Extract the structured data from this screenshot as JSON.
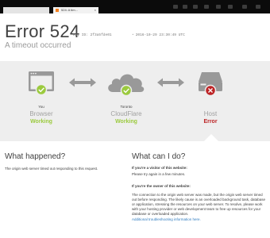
{
  "browser": {
    "tabs": [
      {
        "label": ""
      },
      {
        "label": "524: A tim...",
        "close": "×"
      }
    ]
  },
  "header": {
    "title": "Error 524",
    "ray_id": "Ray ID: 2f3a5fde01",
    "timestamp": "2016-10-29 23:30:49 UTC",
    "subtitle": "A timeout occurred"
  },
  "status": [
    {
      "place": "You",
      "name": "Browser",
      "state": "Working",
      "status": "ok"
    },
    {
      "place": "Toronto",
      "name": "CloudFlare",
      "state": "Working",
      "status": "ok"
    },
    {
      "place": "",
      "name": "Host",
      "state": "Error",
      "status": "error"
    }
  ],
  "what_happened": {
    "heading": "What happened?",
    "text": "The origin web server timed out responding to this request."
  },
  "what_can_i_do": {
    "heading": "What can I do?",
    "visitor_q": "If you're a visitor of this website:",
    "visitor_a": "Please try again in a few minutes.",
    "owner_q": "If you're the owner of this website:",
    "owner_a": "The connection to the origin web server was made, but the origin web server timed out before responding. The likely cause is an overloaded background task, database or application, stressing the resources on your web server. To resolve, please work with your hosting provider or web development team to free up resources for your database or overloaded application.",
    "link": "Additional troubleshooting information here."
  },
  "colors": {
    "ok": "#9bca3e",
    "error": "#bd2426",
    "band": "#eeeeee",
    "link": "#2f7bbf"
  },
  "icons": [
    "browser-window-icon",
    "cloud-icon",
    "server-drive-icon",
    "check-icon",
    "error-x-icon",
    "double-arrow-icon"
  ]
}
